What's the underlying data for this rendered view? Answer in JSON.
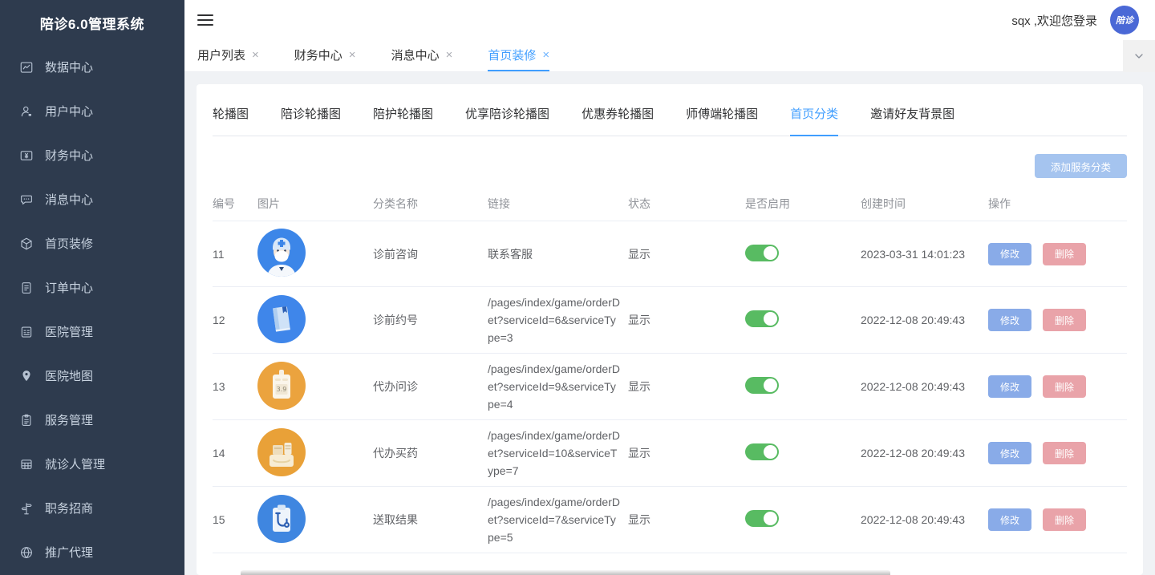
{
  "colors": {
    "sidebar_bg": "#2e3b4e",
    "accent_blue": "#409eff",
    "avatar_bg": "#4a68d6",
    "add_button_bg": "#a5c4ef",
    "edit_button_bg": "#89abe8",
    "delete_button_bg": "#e9a3a9",
    "toggle_on_green": "#58bb62"
  },
  "sidebar": {
    "logo": "陪诊6.0管理系统",
    "items": [
      {
        "label": "数据中心",
        "icon": "chart-icon"
      },
      {
        "label": "用户中心",
        "icon": "user-icon"
      },
      {
        "label": "财务中心",
        "icon": "wallet-icon"
      },
      {
        "label": "消息中心",
        "icon": "message-icon"
      },
      {
        "label": "首页装修",
        "icon": "cube-icon"
      },
      {
        "label": "订单中心",
        "icon": "document-icon"
      },
      {
        "label": "医院管理",
        "icon": "form-icon"
      },
      {
        "label": "医院地图",
        "icon": "location-pin-icon"
      },
      {
        "label": "服务管理",
        "icon": "clipboard-icon"
      },
      {
        "label": "就诊人管理",
        "icon": "grid-icon"
      },
      {
        "label": "职务招商",
        "icon": "signpost-icon"
      },
      {
        "label": "推广代理",
        "icon": "globe-icon"
      }
    ]
  },
  "header": {
    "welcome_text": "sqx ,欢迎您登录",
    "avatar_text": "陪诊"
  },
  "tab_bar": {
    "close_symbol": "×",
    "tabs": [
      {
        "label": "用户列表",
        "active": false
      },
      {
        "label": "财务中心",
        "active": false
      },
      {
        "label": "消息中心",
        "active": false
      },
      {
        "label": "首页装修",
        "active": true
      }
    ]
  },
  "content": {
    "tabs": [
      {
        "label": "轮播图",
        "active": false
      },
      {
        "label": "陪诊轮播图",
        "active": false
      },
      {
        "label": "陪护轮播图",
        "active": false
      },
      {
        "label": "优享陪诊轮播图",
        "active": false
      },
      {
        "label": "优惠券轮播图",
        "active": false
      },
      {
        "label": "师傅端轮播图",
        "active": false
      },
      {
        "label": "首页分类",
        "active": true
      },
      {
        "label": "邀请好友背景图",
        "active": false
      }
    ],
    "add_button_label": "添加服务分类",
    "table": {
      "columns": {
        "id": "编号",
        "image": "图片",
        "name": "分类名称",
        "link": "链接",
        "status": "状态",
        "enabled": "是否启用",
        "created": "创建时间",
        "actions": "操作"
      },
      "edit_label": "修改",
      "delete_label": "删除",
      "rows": [
        {
          "id": "11",
          "image": "nurse-avatar",
          "name": "诊前咨询",
          "link": "联系客服",
          "status": "显示",
          "enabled": true,
          "created": "2023-03-31 14:01:23"
        },
        {
          "id": "12",
          "image": "appointment-book",
          "name": "诊前约号",
          "link": "/pages/index/game/orderDet?serviceId=6&serviceType=3",
          "status": "显示",
          "enabled": true,
          "created": "2022-12-08 20:49:43"
        },
        {
          "id": "13",
          "image": "glucose-meter",
          "image_text": "3.9",
          "name": "代办问诊",
          "link": "/pages/index/game/orderDet?serviceId=9&serviceType=4",
          "status": "显示",
          "enabled": true,
          "created": "2022-12-08 20:49:43"
        },
        {
          "id": "14",
          "image": "medicine-bag",
          "name": "代办买药",
          "link": "/pages/index/game/orderDet?serviceId=10&serviceType=7",
          "status": "显示",
          "enabled": true,
          "created": "2022-12-08 20:49:43"
        },
        {
          "id": "15",
          "image": "report-clipboard",
          "name": "送取结果",
          "link": "/pages/index/game/orderDet?serviceId=7&serviceType=5",
          "status": "显示",
          "enabled": true,
          "created": "2022-12-08 20:49:43"
        }
      ]
    }
  }
}
